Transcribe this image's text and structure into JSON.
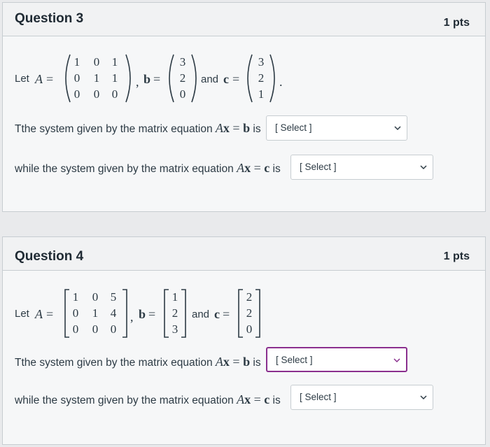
{
  "q3": {
    "title": "Question 3",
    "points": "1 pts",
    "let": "Let",
    "A": "A",
    "eq": "=",
    "A_matrix": [
      [
        "1",
        "0",
        "1"
      ],
      [
        "0",
        "1",
        "1"
      ],
      [
        "0",
        "0",
        "0"
      ]
    ],
    "comma": ",",
    "b": "b",
    "b_vec": [
      "3",
      "2",
      "0"
    ],
    "and": "and",
    "c": "c",
    "c_vec": [
      "3",
      "2",
      "1"
    ],
    "period": ".",
    "line1_text": "Tthe system given by the matrix equation",
    "line1_eq_A": "A",
    "line1_eq_x": "x",
    "line1_eq_eq": " = ",
    "line1_eq_b": "b",
    "line1_is": " is",
    "line2_text": "while  the system given by the matrix equation",
    "line2_eq_c": "c",
    "line2_is": " is",
    "select1": "[ Select ]",
    "select2": "[ Select ]"
  },
  "q4": {
    "title": "Question 4",
    "points": "1 pts",
    "let": "Let",
    "A": "A",
    "eq": "=",
    "A_matrix": [
      [
        "1",
        "0",
        "5"
      ],
      [
        "0",
        "1",
        "4"
      ],
      [
        "0",
        "0",
        "0"
      ]
    ],
    "comma": ",",
    "b": "b",
    "b_vec": [
      "1",
      "2",
      "3"
    ],
    "and": "and",
    "c": "c",
    "c_vec": [
      "2",
      "2",
      "0"
    ],
    "line1_text": "Tthe system given by the matrix equation",
    "line1_eq_A": "A",
    "line1_eq_x": "x",
    "line1_eq_eq": " = ",
    "line1_eq_b": "b",
    "line1_is": " is",
    "line2_text": "while  the system given by the matrix equation",
    "line2_eq_c": "c",
    "line2_is": " is",
    "select1": "[ Select ]",
    "select2": "[ Select ]"
  }
}
